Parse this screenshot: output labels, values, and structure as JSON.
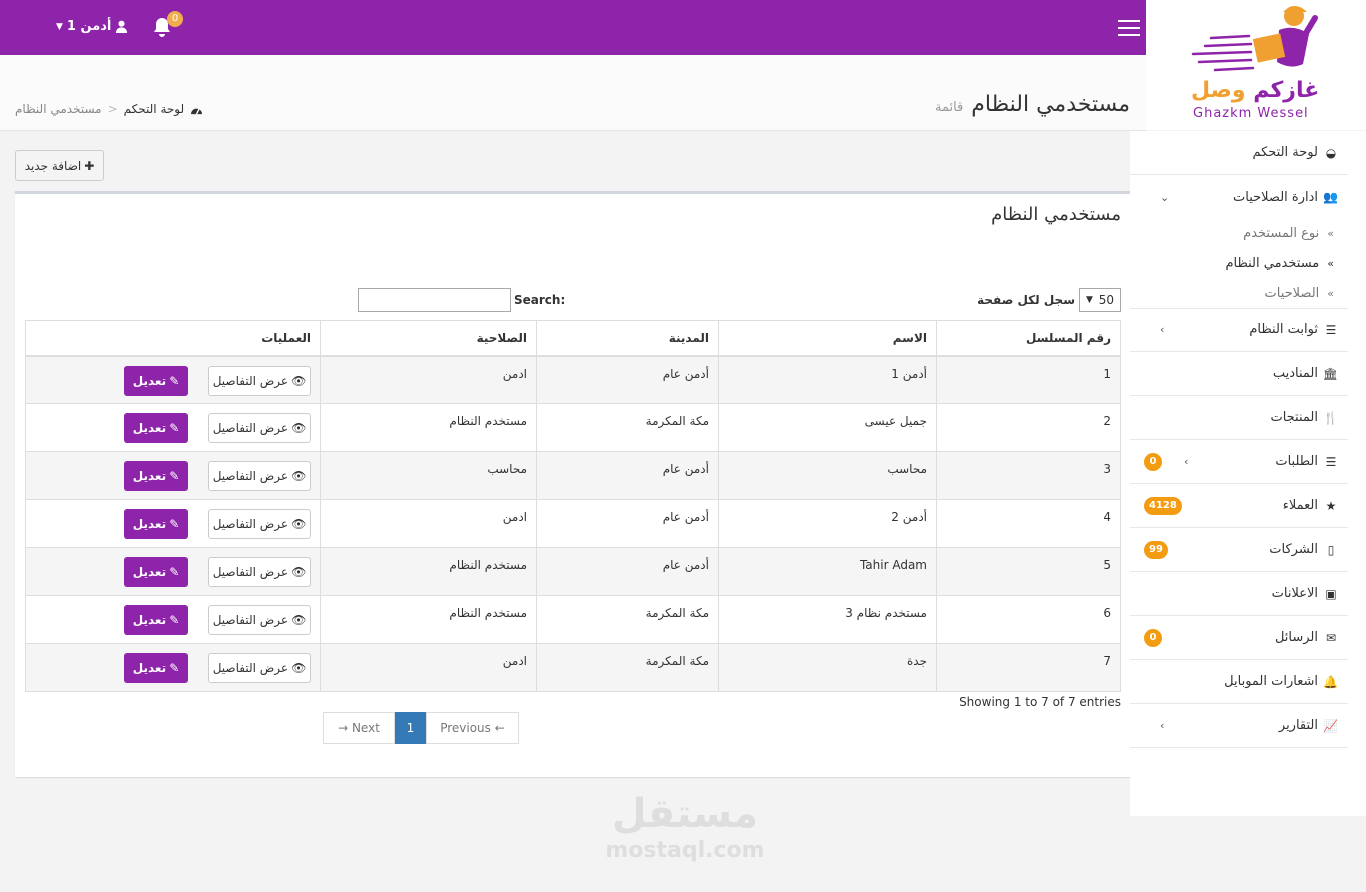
{
  "topbar": {
    "user_name": "أدمن 1",
    "notification_count": "0"
  },
  "logo": {
    "arabic_part1": "غازكم",
    "arabic_part2": "وصل",
    "english": "Ghazkm Wessel"
  },
  "page": {
    "title": "مستخدمي النظام",
    "subtitle": "قائمة"
  },
  "breadcrumb": {
    "home": "لوحة التحكم",
    "current": "مستخدمي النظام"
  },
  "add_button": "اضافة جديد",
  "box": {
    "title": "مستخدمي النظام",
    "length_label": "سجل لكل صفحة",
    "length_value": "50",
    "search_label": "Search:",
    "search_value": "",
    "columns": [
      "رقم المسلسل",
      "الاسم",
      "المدينة",
      "الصلاحية",
      "العمليات"
    ],
    "rows": [
      {
        "id": "1",
        "name": "أدمن 1",
        "city": "أدمن عام",
        "role": "ادمن"
      },
      {
        "id": "2",
        "name": "جميل عيسى",
        "city": "مكة المكرمة",
        "role": "مستخدم النظام"
      },
      {
        "id": "3",
        "name": "محاسب",
        "city": "أدمن عام",
        "role": "محاسب"
      },
      {
        "id": "4",
        "name": "أدمن 2",
        "city": "أدمن عام",
        "role": "ادمن"
      },
      {
        "id": "5",
        "name": "Tahir Adam",
        "city": "أدمن عام",
        "role": "مستخدم النظام"
      },
      {
        "id": "6",
        "name": "مستخدم نظام 3",
        "city": "مكة المكرمة",
        "role": "مستخدم النظام"
      },
      {
        "id": "7",
        "name": "جدة",
        "city": "مكة المكرمة",
        "role": "ادمن"
      }
    ],
    "details_label": "عرض التفاصيل",
    "edit_label": "تعديل",
    "info": "Showing 1 to 7 of 7 entries",
    "pagination": {
      "next": "→ Next",
      "page": "1",
      "previous": "Previous ←"
    }
  },
  "sidebar": {
    "dashboard": "لوحة التحكم",
    "permissions_admin": "ادارة الصلاحيات",
    "sub_user_type": "نوع المستخدم",
    "sub_system_users": "مستخدمي النظام",
    "sub_permissions": "الصلاحيات",
    "system_constants": "ثوابت النظام",
    "delegates": "المناديب",
    "products": "المنتجات",
    "orders": "الطلبات",
    "orders_count": "0",
    "customers": "العملاء",
    "customers_count": "4128",
    "companies": "الشركات",
    "companies_count": "99",
    "ads": "الاعلانات",
    "messages": "الرسائل",
    "messages_count": "0",
    "mobile_notifications": "اشعارات الموبايل",
    "reports": "التقارير"
  },
  "watermark": {
    "arabic": "مستقل",
    "english": "mostaql.com"
  },
  "colors": {
    "brand_purple": "#8e24aa",
    "badge_orange": "#f39c12",
    "page_blue": "#337ab7"
  }
}
